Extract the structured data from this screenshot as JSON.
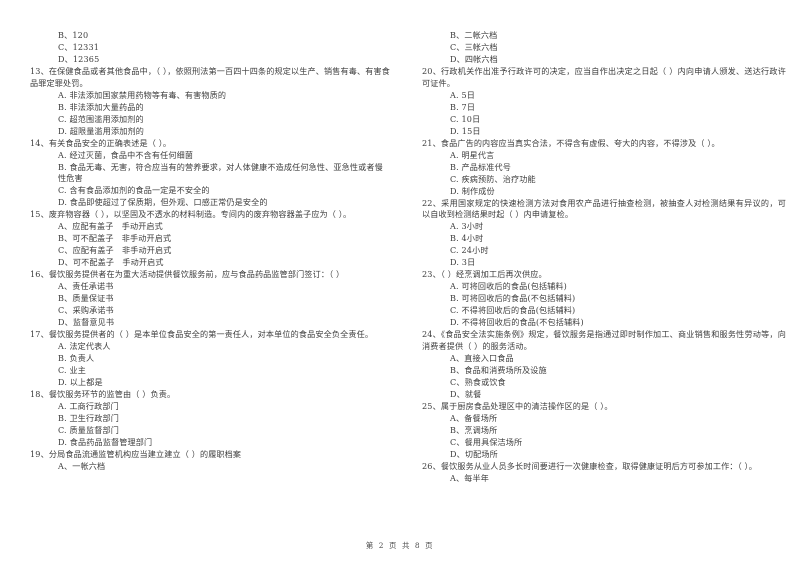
{
  "document": {
    "type": "exam-paper",
    "language": "zh-CN",
    "footer": "第 2 页 共 8 页"
  },
  "left_column": {
    "orphan_options": [
      "B、120",
      "C、12331",
      "D、12365"
    ],
    "questions": [
      {
        "number": "13",
        "stem": "13、在保健食品或者其他食品中，（      ），依照刑法第一百四十四条的规定以生产、销售有毒、有害食品罪定罪处罚。",
        "options": [
          "A. 非法添加国家禁用药物等有毒、有害物质的",
          "B. 非法添加大量药品的",
          "C. 超范围滥用添加剂的",
          "D. 超限量滥用添加剂的"
        ]
      },
      {
        "number": "14",
        "stem": "14、有关食品安全的正确表述是（      ）。",
        "options": [
          "A. 经过灭菌，食品中不含有任何细菌",
          "B. 食品无毒、无害，符合应当有的营养要求，对人体健康不造成任何急性、亚急性或者慢性危害",
          "C. 含有食品添加剂的食品一定是不安全的",
          "D. 食品即使超过了保质期，但外观、口感正常仍是安全的"
        ]
      },
      {
        "number": "15",
        "stem": "15、废弃物容器（          ），以坚固及不透水的材料制造。专间内的废弃物容器盖子应为（      ）。",
        "options": [
          "A、应配有盖子　手动开启式",
          "B、可不配盖子　非手动开启式",
          "C、应配有盖子　非手动开启式",
          "D、可不配盖子　手动开启式"
        ]
      },
      {
        "number": "16",
        "stem": "16、餐饮服务提供者在为重大活动提供餐饮服务前，应与食品药品监管部门签订：（      ）",
        "options": [
          "A、责任承诺书",
          "B、质量保证书",
          "C、采购承诺书",
          "D、监督意见书"
        ]
      },
      {
        "number": "17",
        "stem": "17、餐饮服务提供者的（      ）是本单位食品安全的第一责任人，对本单位的食品安全负全责任。",
        "options": [
          "A. 法定代表人",
          "B. 负责人",
          "C. 业主",
          "D. 以上都是"
        ]
      },
      {
        "number": "18",
        "stem": "18、餐饮服务环节的监管由（      ）负责。",
        "options": [
          "A. 工商行政部门",
          "B. 卫生行政部门",
          "C. 质量监督部门",
          "D. 食品药品监督管理部门"
        ]
      },
      {
        "number": "19",
        "stem": "19、分局食品流通监管机构应当建立建立（    ）的履职档案",
        "options": [
          "A、一帐六档"
        ]
      }
    ]
  },
  "right_column": {
    "orphan_options": [
      "B、二帐六档",
      "C、三帐六档",
      "D、四帐六档"
    ],
    "questions": [
      {
        "number": "20",
        "stem": "20、行政机关作出准予行政许可的决定，应当自作出决定之日起（      ）内向申请人颁发、送达行政许可证件。",
        "options": [
          "A. 5日",
          "B. 7日",
          "C. 10日",
          "D. 15日"
        ]
      },
      {
        "number": "21",
        "stem": "21、食品广告的内容应当真实合法，不得含有虚假、夸大的内容，不得涉及（      ）。",
        "options": [
          "A. 明星代言",
          "B. 产品标准代号",
          "C. 疾病预防、治疗功能",
          "D. 制作成份"
        ]
      },
      {
        "number": "22",
        "stem": "22、采用国家规定的快速检测方法对食用农产品进行抽查检测，被抽查人对检测结果有异议的，可以自收到检测结果时起（      ）内申请复检。",
        "options": [
          "A. 3小时",
          "B. 4小时",
          "C. 24小时",
          "D. 3日"
        ]
      },
      {
        "number": "23",
        "stem": "23、（      ）经烹调加工后再次供应。",
        "options": [
          "A. 可将回收后的食品(包括辅料)",
          "B. 可将回收后的食品(不包括辅料)",
          "C. 不得将回收后的食品(包括辅料)",
          "D. 不得将回收后的食品(不包括辅料)"
        ]
      },
      {
        "number": "24",
        "stem": "24、《食品安全法实施条例》规定，餐饮服务是指通过即时制作加工、商业销售和服务性劳动等，向消费者提供（      ）的服务活动。",
        "options": [
          "A、直接入口食品",
          "B、食品和消费场所及设施",
          "C、熟食或饮食",
          "D、就餐"
        ]
      },
      {
        "number": "25",
        "stem": "25、属于厨房食品处理区中的清洁操作区的是（      ）。",
        "options": [
          "A、备餐场所",
          "B、烹调场所",
          "C、餐用具保洁场所",
          "D、切配场所"
        ]
      },
      {
        "number": "26",
        "stem": "26、餐饮服务从业人员多长时间要进行一次健康检查，取得健康证明后方可参加工作：（      ）。",
        "options": [
          "A、每半年"
        ]
      }
    ]
  }
}
